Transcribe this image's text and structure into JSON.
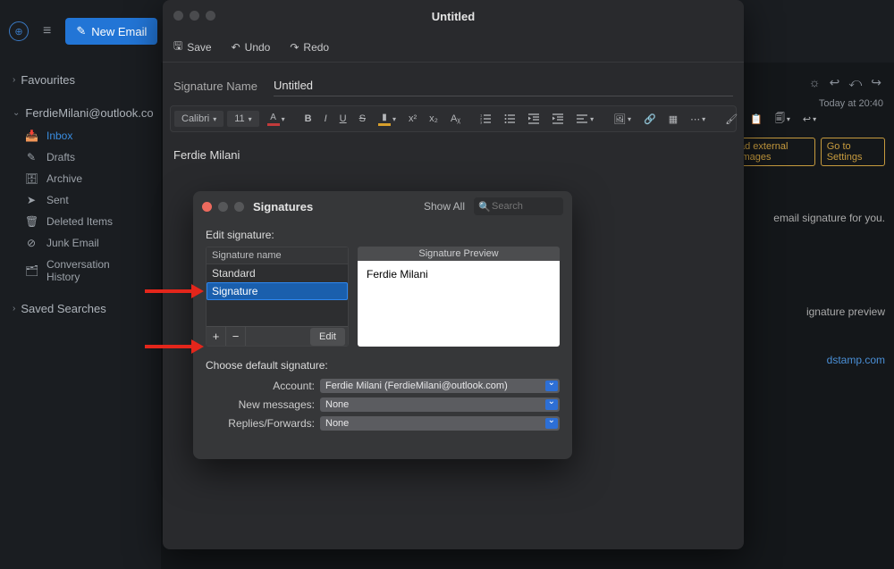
{
  "app_topbar": {
    "new_email_label": "New Email"
  },
  "sidebar": {
    "favourites_label": "Favourites",
    "account_label": "FerdieMilani@outlook.co",
    "items": [
      {
        "label": "Inbox"
      },
      {
        "label": "Drafts"
      },
      {
        "label": "Archive"
      },
      {
        "label": "Sent"
      },
      {
        "label": "Deleted Items"
      },
      {
        "label": "Junk Email"
      },
      {
        "label": "Conversation History"
      }
    ],
    "saved_searches_label": "Saved Searches"
  },
  "bg_right": {
    "time": "Today at 20:40",
    "load_images_label": "ad external images",
    "settings_label": "Go to Settings",
    "text1": "email signature for you.",
    "text2": "ignature preview",
    "link": "dstamp.com"
  },
  "editor": {
    "window_title": "Untitled",
    "toolbar": {
      "save_label": "Save",
      "undo_label": "Undo",
      "redo_label": "Redo"
    },
    "signature_name_label": "Signature Name",
    "signature_name_value": "Untitled",
    "font_name": "Calibri",
    "font_size": "11",
    "body_text": "Ferdie Milani"
  },
  "signatures_dialog": {
    "title": "Signatures",
    "show_all_label": "Show All",
    "search_placeholder": "Search",
    "edit_signature_label": "Edit signature:",
    "list_header": "Signature name",
    "rows": [
      {
        "name": "Standard"
      },
      {
        "name": "Signature"
      }
    ],
    "add_label": "+",
    "remove_label": "−",
    "edit_btn_label": "Edit",
    "preview_header": "Signature Preview",
    "preview_body": "Ferdie Milani",
    "default_section_label": "Choose default signature:",
    "account_label": "Account:",
    "account_value": "Ferdie Milani (FerdieMilani@outlook.com)",
    "new_messages_label": "New messages:",
    "new_messages_value": "None",
    "replies_label": "Replies/Forwards:",
    "replies_value": "None"
  }
}
